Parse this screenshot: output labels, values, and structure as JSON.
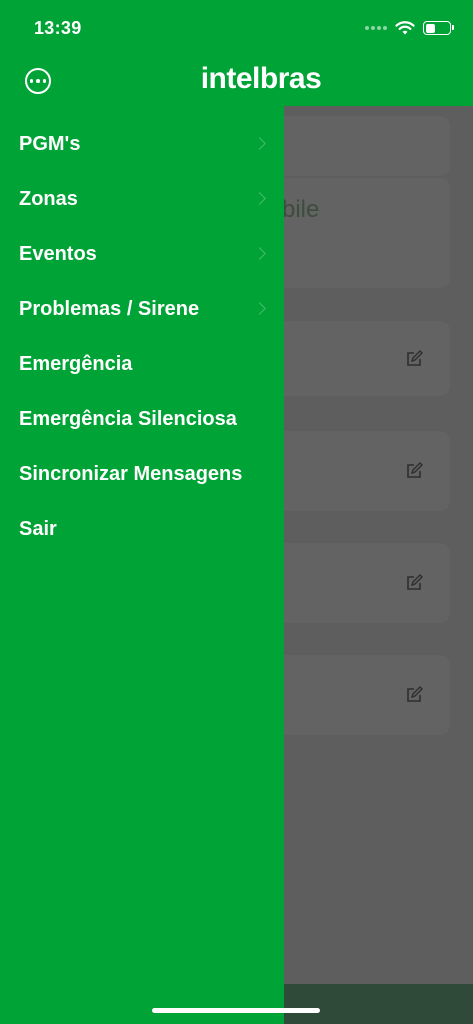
{
  "status_bar": {
    "time": "13:39"
  },
  "header": {
    "logo": "intelbras",
    "more_icon": "more-horizontal-circle-icon"
  },
  "background": {
    "partial_title": "bile"
  },
  "menu": {
    "items": [
      {
        "label": "PGM's",
        "has_chevron": true
      },
      {
        "label": "Zonas",
        "has_chevron": true
      },
      {
        "label": "Eventos",
        "has_chevron": true
      },
      {
        "label": "Problemas / Sirene",
        "has_chevron": true
      },
      {
        "label": "Emergência",
        "has_chevron": false
      },
      {
        "label": "Emergência Silenciosa",
        "has_chevron": false
      },
      {
        "label": "Sincronizar Mensagens",
        "has_chevron": false
      },
      {
        "label": "Sair",
        "has_chevron": false
      }
    ]
  },
  "colors": {
    "brand_green": "#00a335",
    "overlay": "#5e5e5e"
  }
}
